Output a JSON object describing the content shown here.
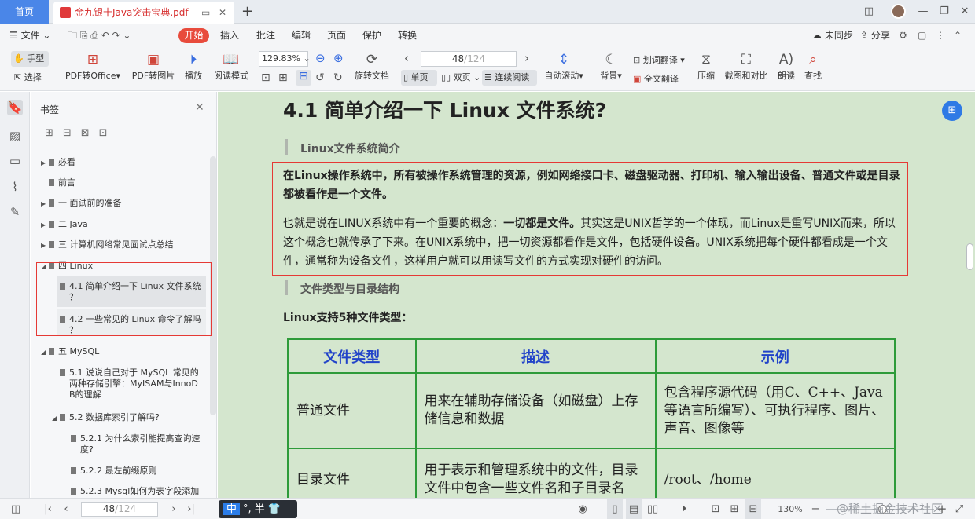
{
  "titlebar": {
    "home_tab": "首页",
    "doc_tab": "金九银十Java突击宝典.pdf"
  },
  "menubar": {
    "file": "文件",
    "start": "开始",
    "items": [
      "插入",
      "批注",
      "编辑",
      "页面",
      "保护",
      "转换"
    ],
    "unsynced": "未同步",
    "share": "分享"
  },
  "toolbar": {
    "hand": "手型",
    "select": "选择",
    "pdf_to_office": "PDF转Office",
    "pdf_to_image": "PDF转图片",
    "play": "播放",
    "read_mode": "阅读模式",
    "zoom": "129.83%",
    "rotate": "旋转文档",
    "page_current": "48",
    "page_total": "/124",
    "single": "单页",
    "double": "双页",
    "continuous": "连续阅读",
    "auto_scroll": "自动滚动",
    "background": "背景",
    "word_translate": "划词翻译",
    "full_translate": "全文翻译",
    "compress": "压缩",
    "screenshot": "截图和对比",
    "read_aloud": "朗读",
    "find": "查找"
  },
  "bookmarks": {
    "title": "书签",
    "items": [
      {
        "label": "必看"
      },
      {
        "label": "前言"
      },
      {
        "label": "一 面试前的准备"
      },
      {
        "label": "二 Java"
      },
      {
        "label": "三  计算机网络常见面试点总结"
      },
      {
        "label": "四 Linux"
      },
      {
        "label": "4.1 简单介绍一下 Linux 文件系统",
        "cont": "？"
      },
      {
        "label": "4.2 一些常见的 Linux 命令了解吗",
        "cont": "？"
      },
      {
        "label": "五 MySQL"
      },
      {
        "label": "5.1 说说自己对于 MySQL 常见的",
        "cont": "两种存储引擎：MyISAM与InnoD",
        "cont2": "B的理解"
      },
      {
        "label": "5.2 数据库索引了解吗?"
      },
      {
        "label": "5.2.1 为什么索引能提高查询速",
        "cont": "度?"
      },
      {
        "label": "5.2.2 最左前缀原则"
      },
      {
        "label": "5.2.3 Mysql如何为表字段添加"
      }
    ]
  },
  "document": {
    "title": "4.1 简单介绍一下 Linux 文件系统?",
    "section1": "Linux文件系统简介",
    "bold_para": "在Linux操作系统中，所有被操作系统管理的资源，例如网络接口卡、磁盘驱动器、打印机、输入输出设备、普通文件或是目录都被看作是一个文件。",
    "para_start": "也就是说在LINUX系统中有一个重要的概念：",
    "para_bold": "一切都是文件。",
    "para_rest": "其实这是UNIX哲学的一个体现，而Linux是重写UNIX而来，所以这个概念也就传承了下来。在UNIX系统中，把一切资源都看作是文件，包括硬件设备。UNIX系统把每个硬件都看成是一个文件，通常称为设备文件，这样用户就可以用读写文件的方式实现对硬件的访问。",
    "section2": "文件类型与目录结构",
    "types_intro": "Linux支持5种文件类型：",
    "table": {
      "headers": [
        "文件类型",
        "描述",
        "示例"
      ],
      "rows": [
        [
          "普通文件",
          "用来在辅助存储设备（如磁盘）上存储信息和数据",
          "包含程序源代码（用C、C++、Java等语言所编写）、可执行程序、图片、声音、图像等"
        ],
        [
          "目录文件",
          "用于表示和管理系统中的文件，目录文件中包含一些文件名和子目录名",
          "/root、/home"
        ]
      ]
    }
  },
  "statusbar": {
    "page": "48",
    "total": "/124",
    "ime": "°, 半",
    "zoom": "130%",
    "watermark": "@稀土掘金技术社区"
  }
}
